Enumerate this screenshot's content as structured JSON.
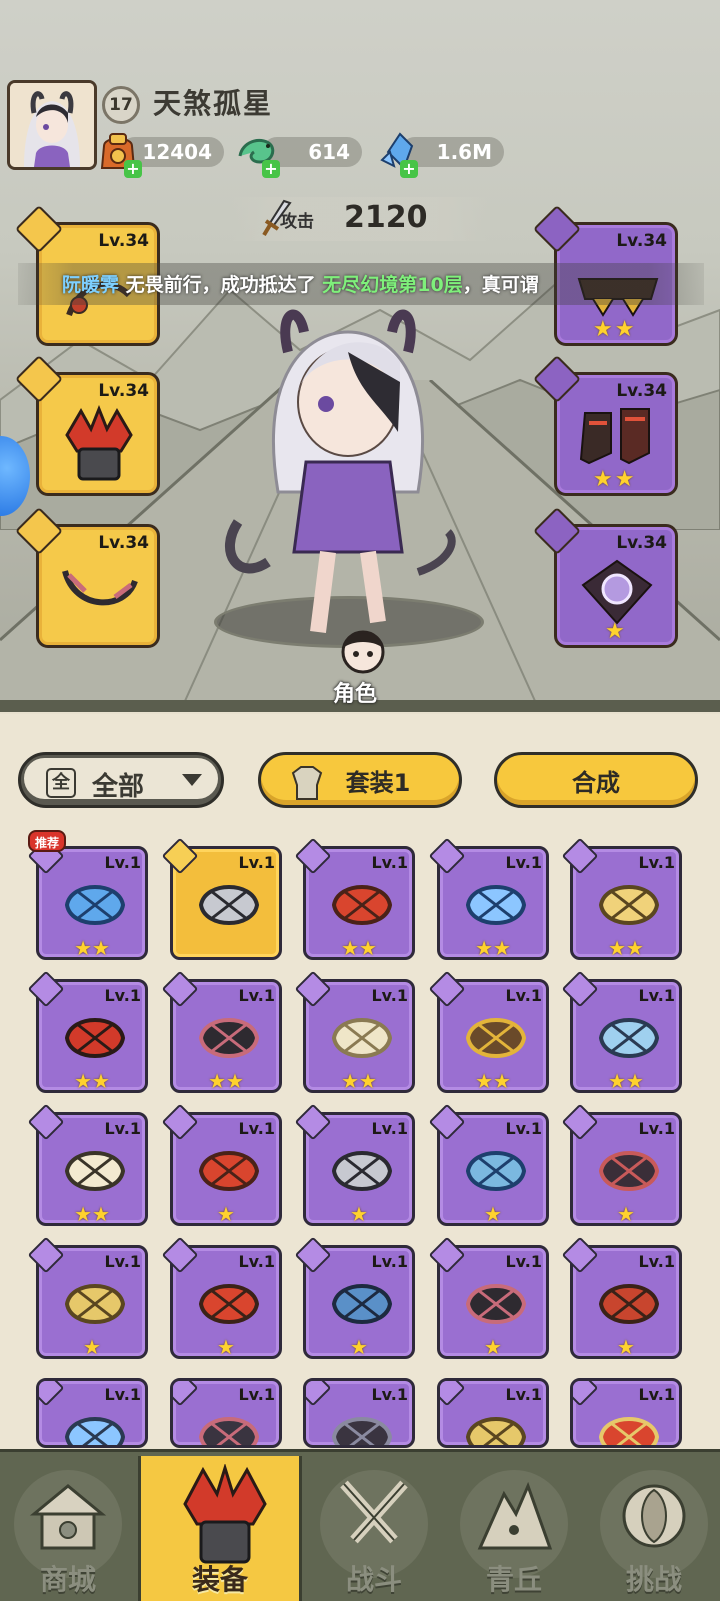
{
  "player": {
    "level": "17",
    "name": "天煞孤星"
  },
  "resources": [
    {
      "icon": "gold-bag-icon",
      "value": "12404"
    },
    {
      "icon": "jade-dragon-icon",
      "value": "614"
    },
    {
      "icon": "crystal-icon",
      "value": "1.6M"
    }
  ],
  "attack": {
    "label": "攻击",
    "value": "2120"
  },
  "marquee": {
    "player": "阮暖霁",
    "text1": " 无畏前行，成功抵达了 ",
    "place": "无尽幻境第10层",
    "text2": "，真可谓"
  },
  "equipped_left": [
    {
      "level": "Lv.34",
      "type": "weapon",
      "color": "#f5c94a"
    },
    {
      "level": "Lv.34",
      "type": "helmet",
      "color": "#f5c94a"
    },
    {
      "level": "Lv.34",
      "type": "necklace",
      "color": "#f5c94a"
    }
  ],
  "equipped_right": [
    {
      "level": "Lv.34",
      "type": "belt",
      "stars": 2
    },
    {
      "level": "Lv.34",
      "type": "boots",
      "stars": 2
    },
    {
      "level": "Lv.34",
      "type": "amulet",
      "stars": 1
    }
  ],
  "role_button": {
    "label": "角色"
  },
  "inventory": {
    "filter": {
      "icon_text": "全",
      "label": "全部"
    },
    "set_button": "套装1",
    "craft_button": "合成",
    "recommend_badge": "推荐",
    "items": [
      {
        "level": "Lv.1",
        "stars": 2,
        "rarity": "purple",
        "kind": "amulet-blue"
      },
      {
        "level": "Lv.1",
        "stars": 0,
        "rarity": "gold",
        "kind": "hammer"
      },
      {
        "level": "Lv.1",
        "stars": 2,
        "rarity": "purple",
        "kind": "torch"
      },
      {
        "level": "Lv.1",
        "stars": 2,
        "rarity": "purple",
        "kind": "bow"
      },
      {
        "level": "Lv.1",
        "stars": 2,
        "rarity": "purple",
        "kind": "staff"
      },
      {
        "level": "Lv.1",
        "stars": 2,
        "rarity": "purple",
        "kind": "helmet-red"
      },
      {
        "level": "Lv.1",
        "stars": 2,
        "rarity": "purple",
        "kind": "necklace-dark"
      },
      {
        "level": "Lv.1",
        "stars": 2,
        "rarity": "purple",
        "kind": "fur-necklace"
      },
      {
        "level": "Lv.1",
        "stars": 2,
        "rarity": "purple",
        "kind": "belt-gold"
      },
      {
        "level": "Lv.1",
        "stars": 2,
        "rarity": "purple",
        "kind": "boots-ice"
      },
      {
        "level": "Lv.1",
        "stars": 2,
        "rarity": "purple",
        "kind": "horn-amulet"
      },
      {
        "level": "Lv.1",
        "stars": 1,
        "rarity": "purple",
        "kind": "torch"
      },
      {
        "level": "Lv.1",
        "stars": 1,
        "rarity": "purple",
        "kind": "hammer"
      },
      {
        "level": "Lv.1",
        "stars": 1,
        "rarity": "purple",
        "kind": "armor-ice"
      },
      {
        "level": "Lv.1",
        "stars": 1,
        "rarity": "purple",
        "kind": "armor-dark"
      },
      {
        "level": "Lv.1",
        "stars": 1,
        "rarity": "purple",
        "kind": "armor-gold"
      },
      {
        "level": "Lv.1",
        "stars": 1,
        "rarity": "purple",
        "kind": "necklace-red"
      },
      {
        "level": "Lv.1",
        "stars": 1,
        "rarity": "purple",
        "kind": "necklace-blue"
      },
      {
        "level": "Lv.1",
        "stars": 1,
        "rarity": "purple",
        "kind": "necklace-dark"
      },
      {
        "level": "Lv.1",
        "stars": 1,
        "rarity": "purple",
        "kind": "belt-red"
      },
      {
        "level": "Lv.1",
        "stars": 0,
        "rarity": "purple",
        "kind": "belt-ice"
      },
      {
        "level": "Lv.1",
        "stars": 0,
        "rarity": "purple",
        "kind": "belt-dark"
      },
      {
        "level": "Lv.1",
        "stars": 0,
        "rarity": "purple",
        "kind": "boots-dark"
      },
      {
        "level": "Lv.1",
        "stars": 0,
        "rarity": "purple",
        "kind": "boots-gold"
      },
      {
        "level": "Lv.1",
        "stars": 0,
        "rarity": "purple",
        "kind": "amulet-red"
      }
    ]
  },
  "nav": [
    {
      "label": "商城",
      "icon": "shop-icon",
      "active": false
    },
    {
      "label": "装备",
      "icon": "equipment-icon",
      "active": true
    },
    {
      "label": "战斗",
      "icon": "battle-icon",
      "active": false
    },
    {
      "label": "青丘",
      "icon": "qingqiu-icon",
      "active": false
    },
    {
      "label": "挑战",
      "icon": "challenge-icon",
      "active": false
    }
  ],
  "colors": {
    "gold_slot": "#f5c94a",
    "purple_slot": "#9a6fd1",
    "nav_active": "#f5c842",
    "nav_bg": "#606651",
    "star": "#ffd22e"
  }
}
